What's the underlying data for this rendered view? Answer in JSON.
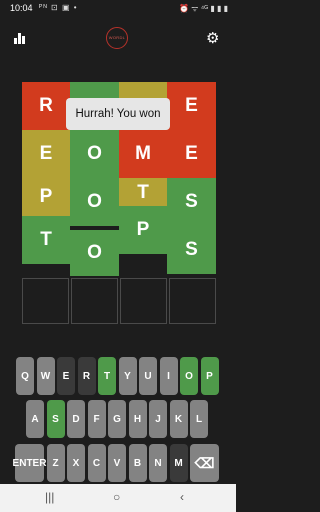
{
  "status": {
    "time": "10:04",
    "icons": "ᴾᴺ ⊡ ▣ •",
    "right": "⏰ ᯤ ⁴ᴳ ▮ ▮ ▮"
  },
  "app": {
    "logo_text": "WORDL",
    "toast": "Hurrah! You won"
  },
  "board": {
    "tiles": [
      {
        "letter": "R",
        "state": "red"
      },
      {
        "letter": "",
        "state": "green"
      },
      {
        "letter": "",
        "state": "yellow"
      },
      {
        "letter": "E",
        "state": "red"
      },
      {
        "letter": "E",
        "state": "yellow"
      },
      {
        "letter": "S",
        "state": "green"
      },
      {
        "letter": "O",
        "state": "green"
      },
      {
        "letter": "M",
        "state": "red"
      },
      {
        "letter": "E",
        "state": "red"
      },
      {
        "letter": "P",
        "state": "yellow"
      },
      {
        "letter": "O",
        "state": "green"
      },
      {
        "letter": "T",
        "state": "yellow"
      },
      {
        "letter": "S",
        "state": "green"
      },
      {
        "letter": "T",
        "state": "green"
      },
      {
        "letter": "O",
        "state": "green"
      },
      {
        "letter": "P",
        "state": "green"
      },
      {
        "letter": "S",
        "state": "green"
      }
    ]
  },
  "keyboard": {
    "row1": [
      {
        "label": "Q",
        "state": "l"
      },
      {
        "label": "W",
        "state": "l"
      },
      {
        "label": "E",
        "state": "d"
      },
      {
        "label": "R",
        "state": "d"
      },
      {
        "label": "T",
        "state": "g"
      },
      {
        "label": "Y",
        "state": "l"
      },
      {
        "label": "U",
        "state": "l"
      },
      {
        "label": "I",
        "state": "l"
      },
      {
        "label": "O",
        "state": "g"
      },
      {
        "label": "P",
        "state": "g"
      }
    ],
    "row2": [
      {
        "label": "A",
        "state": "l"
      },
      {
        "label": "S",
        "state": "g"
      },
      {
        "label": "D",
        "state": "l"
      },
      {
        "label": "F",
        "state": "l"
      },
      {
        "label": "G",
        "state": "l"
      },
      {
        "label": "H",
        "state": "l"
      },
      {
        "label": "J",
        "state": "l"
      },
      {
        "label": "K",
        "state": "l"
      },
      {
        "label": "L",
        "state": "l"
      }
    ],
    "row3": [
      {
        "label": "ENTER",
        "state": "l"
      },
      {
        "label": "Z",
        "state": "l"
      },
      {
        "label": "X",
        "state": "l"
      },
      {
        "label": "C",
        "state": "l"
      },
      {
        "label": "V",
        "state": "l"
      },
      {
        "label": "B",
        "state": "l"
      },
      {
        "label": "N",
        "state": "l"
      },
      {
        "label": "M",
        "state": "d"
      },
      {
        "label": "⌫",
        "state": "l"
      }
    ]
  },
  "nav": {
    "recents": "|||",
    "home": "○",
    "back": "‹"
  }
}
